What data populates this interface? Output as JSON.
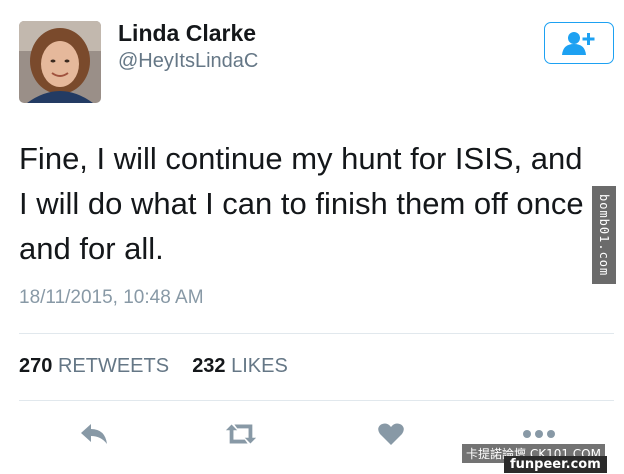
{
  "user": {
    "display_name": "Linda Clarke",
    "handle": "@HeyItsLindaC"
  },
  "follow_button": {
    "icon": "follow-person-plus-icon"
  },
  "tweet": {
    "text": "Fine, I will continue my hunt for ISIS, and I will do what I can to finish them off once and for all.",
    "timestamp": "18/11/2015, 10:48 AM"
  },
  "stats": {
    "retweets_count": "270",
    "retweets_label": "RETWEETS",
    "likes_count": "232",
    "likes_label": "LIKES"
  },
  "actions": {
    "reply_icon": "reply-icon",
    "retweet_icon": "retweet-icon",
    "like_icon": "heart-icon",
    "more_icon": "more-dots-icon"
  },
  "watermarks": {
    "side": "bomb01.com",
    "bottom_1": "卡提諾論壇 CK101.COM",
    "bottom_2": "funpeer.com"
  },
  "colors": {
    "accent": "#1da1f2",
    "text": "#14171a",
    "secondary": "#657786",
    "icon": "#8899a6",
    "divider": "#e1e8ed"
  }
}
